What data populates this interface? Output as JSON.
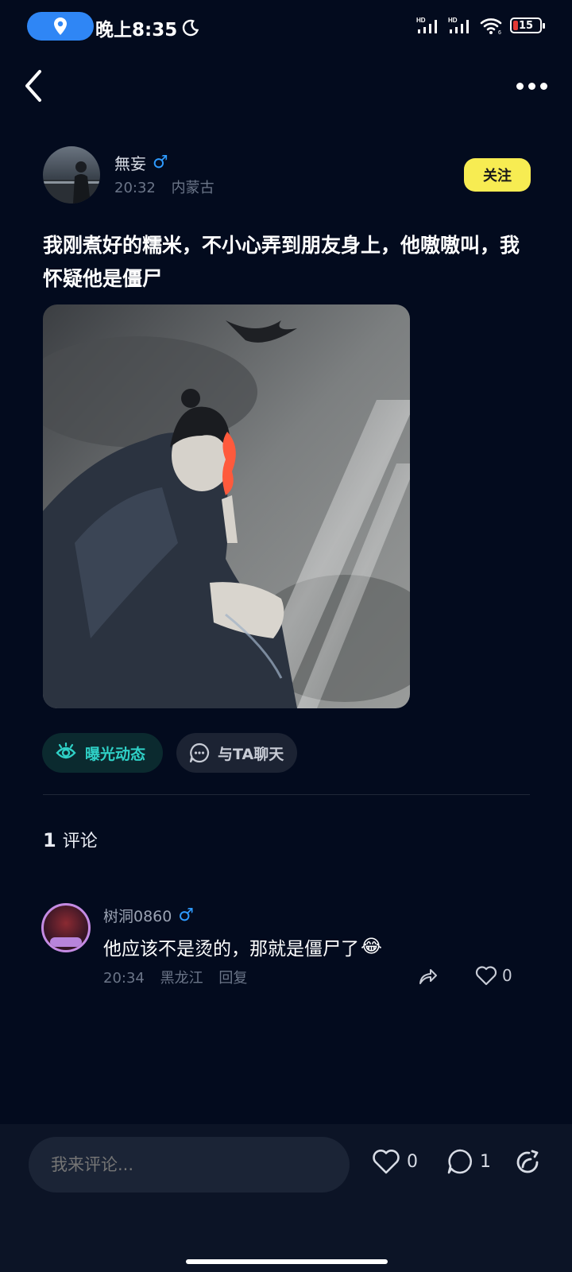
{
  "status_bar": {
    "time": "晚上8:35",
    "battery": "15",
    "icons": [
      "location-icon",
      "moon-icon",
      "hd-signal-icon",
      "hd-signal-icon",
      "wifi-icon",
      "battery-icon"
    ],
    "network_label": "HD"
  },
  "nav": {
    "back_icon": "chevron-left-icon",
    "more_icon": "more-dots-icon"
  },
  "post": {
    "author": {
      "name": "無妄",
      "gender_symbol": "♂",
      "time": "20:32",
      "location": "内蒙古"
    },
    "follow_label": "关注",
    "text": "我刚煮好的糯米，不小心弄到朋友身上，他嗷嗷叫，我怀疑他是僵尸",
    "actions": {
      "expose_label": "曝光动态",
      "chat_label": "与TA聊天"
    }
  },
  "comments": {
    "count": "1",
    "label": "评论",
    "items": [
      {
        "user": "树洞0860",
        "gender_symbol": "♂",
        "text": "他应该不是烫的，那就是僵尸了",
        "emoji": "😂",
        "time": "20:34",
        "location": "黑龙江",
        "reply_label": "回复",
        "likes": "0"
      }
    ]
  },
  "bottom_bar": {
    "input_placeholder": "我来评论...",
    "likes": "0",
    "comments": "1"
  },
  "colors": {
    "background": "#030b1e",
    "follow_button": "#f7ec52",
    "male_icon": "#2e9bff",
    "expose_accent": "#2fd0c6",
    "location_pill": "#2f86f5"
  }
}
